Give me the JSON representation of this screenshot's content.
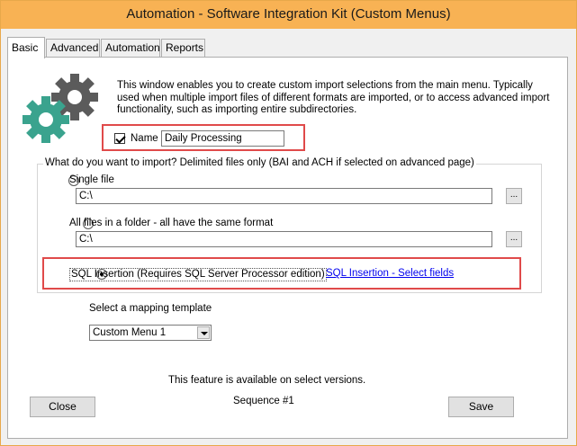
{
  "window": {
    "title": "Automation - Software Integration Kit (Custom Menus)"
  },
  "tabs": [
    {
      "label": "Basic",
      "active": true
    },
    {
      "label": "Advanced",
      "active": false
    },
    {
      "label": "Automation",
      "active": false
    },
    {
      "label": "Reports",
      "active": false
    }
  ],
  "basic": {
    "description": "This window enables you to create custom import selections from the main menu.  Typically used when multiple import files of different formats are imported, or to access advanced import functionality, such as importing entire subdirectories.",
    "name_checkbox": {
      "checked": true,
      "label": "Name",
      "value": "Daily Processing"
    },
    "import_group": {
      "legend": "What do you want to import?  Delimited files only (BAI and ACH if selected on advanced page)",
      "single_file": {
        "label": "Single file",
        "path": "C:\\",
        "browse_label": "..."
      },
      "all_files": {
        "label": "All files in a folder - all have the same format",
        "path": "C:\\",
        "browse_label": "..."
      },
      "sql_insertion": {
        "label": "SQL Insertion (Requires SQL Server Processor edition)",
        "link": "SQL Insertion - Select fields",
        "selected": true
      }
    },
    "mapping": {
      "label": "Select a mapping template",
      "selected": "Custom Menu 1"
    },
    "availability_note": "This feature is available on select versions.",
    "sequence": "Sequence #1"
  },
  "buttons": {
    "close": "Close",
    "save": "Save"
  },
  "colors": {
    "titlebar": "#f8b254",
    "highlight_box": "#e04a4a",
    "gear_dark": "#5b5b5b",
    "gear_teal": "#3aa38e"
  }
}
